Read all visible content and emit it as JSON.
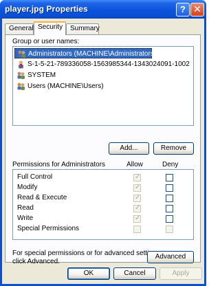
{
  "window": {
    "title": "player.jpg Properties",
    "help_button": "?",
    "close_button": "✕"
  },
  "tabs": [
    {
      "label": "General"
    },
    {
      "label": "Security"
    },
    {
      "label": "Summary"
    }
  ],
  "security": {
    "group_label": "Group or user names:",
    "users": [
      {
        "name": "Administrators (MACHINE\\Administrators)"
      },
      {
        "name": "S-1-5-21-789336058-1563985344-1343024091-1002"
      },
      {
        "name": "SYSTEM"
      },
      {
        "name": "Users (MACHINE\\Users)"
      }
    ],
    "add_button": "Add...",
    "remove_button": "Remove",
    "permissions_label": "Permissions for Administrators",
    "allow_header": "Allow",
    "deny_header": "Deny",
    "permissions": [
      {
        "name": "Full Control",
        "allow": true,
        "deny": false
      },
      {
        "name": "Modify",
        "allow": true,
        "deny": false
      },
      {
        "name": "Read & Execute",
        "allow": true,
        "deny": false
      },
      {
        "name": "Read",
        "allow": true,
        "deny": false
      },
      {
        "name": "Write",
        "allow": true,
        "deny": false
      },
      {
        "name": "Special Permissions",
        "allow": false,
        "deny": false
      }
    ],
    "advanced_note_line1": "For special permissions or for advanced settings,",
    "advanced_note_line2": "click Advanced.",
    "advanced_button": "Advanced"
  },
  "footer": {
    "ok": "OK",
    "cancel": "Cancel",
    "apply": "Apply"
  },
  "colors": {
    "titlebar": "#0a55dd",
    "selection": "#316ac5",
    "face": "#ece9d8",
    "tab_accent": "#f7b23b"
  }
}
